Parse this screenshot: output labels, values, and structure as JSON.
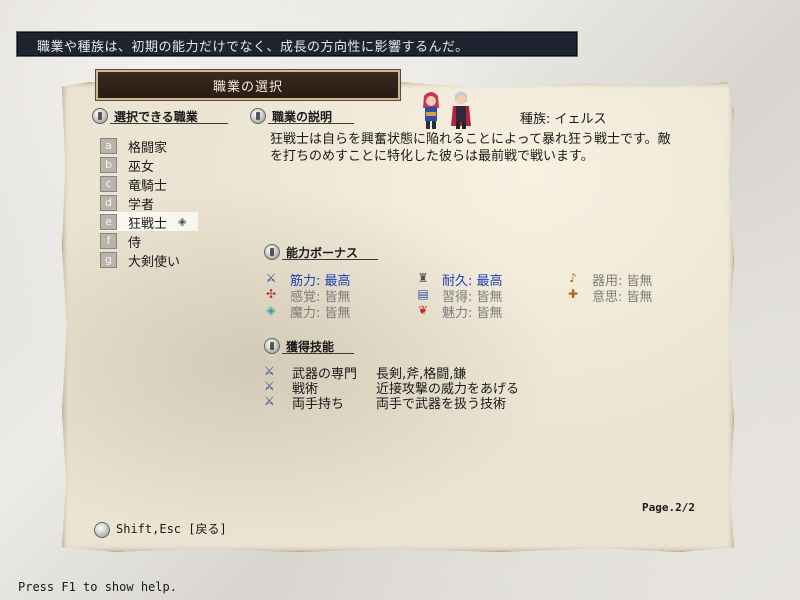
{
  "message": "職業や種族は、初期の能力だけでなく、成長の方向性に影響するんだ。",
  "title": "職業の選択",
  "sections": {
    "jobs_header": "選択できる職業",
    "desc_header": "職業の説明",
    "bonus_header": "能力ボーナス",
    "skills_header": "獲得技能"
  },
  "jobs": [
    {
      "key": "a",
      "name": "格闘家"
    },
    {
      "key": "b",
      "name": "巫女"
    },
    {
      "key": "c",
      "name": "竜騎士"
    },
    {
      "key": "d",
      "name": "学者"
    },
    {
      "key": "e",
      "name": "狂戦士",
      "selected": true
    },
    {
      "key": "f",
      "name": "侍"
    },
    {
      "key": "g",
      "name": "大剣使い"
    }
  ],
  "race": "種族: イェルス",
  "description_lines": [
    "狂戦士は自らを興奮状態に陥れることによって暴れ狂う戦士です。敵",
    "を打ちのめすことに特化した彼らは最前戦で戦います。"
  ],
  "bonuses": [
    {
      "icon": "crossed-swords-icon",
      "text": "筋力: 最高",
      "level": "high"
    },
    {
      "icon": "armor-icon",
      "text": "耐久: 最高",
      "level": "high"
    },
    {
      "icon": "hand-icon",
      "text": "器用: 皆無",
      "level": "none"
    },
    {
      "icon": "sense-icon",
      "text": "感覚: 皆無",
      "level": "none"
    },
    {
      "icon": "book-icon",
      "text": "習得: 皆無",
      "level": "none"
    },
    {
      "icon": "will-icon",
      "text": "意思: 皆無",
      "level": "none"
    },
    {
      "icon": "magic-icon",
      "text": "魔力: 皆無",
      "level": "none"
    },
    {
      "icon": "charm-icon",
      "text": "魅力: 皆無",
      "level": "none"
    }
  ],
  "skills": [
    {
      "name": "武器の専門",
      "desc": "長剣,斧,格闘,鎌"
    },
    {
      "name": "戦術",
      "desc": "近接攻撃の威力をあげる"
    },
    {
      "name": "両手持ち",
      "desc": "両手で武器を扱う技術"
    }
  ],
  "page": "Page.2/2",
  "hint": "Shift,Esc [戻る]",
  "help": "Press F1 to show help.",
  "colors": {
    "high": "#1f3fb8",
    "none": "#7d7d7d",
    "title_bg": "#2e1f16",
    "message_bg": "#1d2430"
  }
}
